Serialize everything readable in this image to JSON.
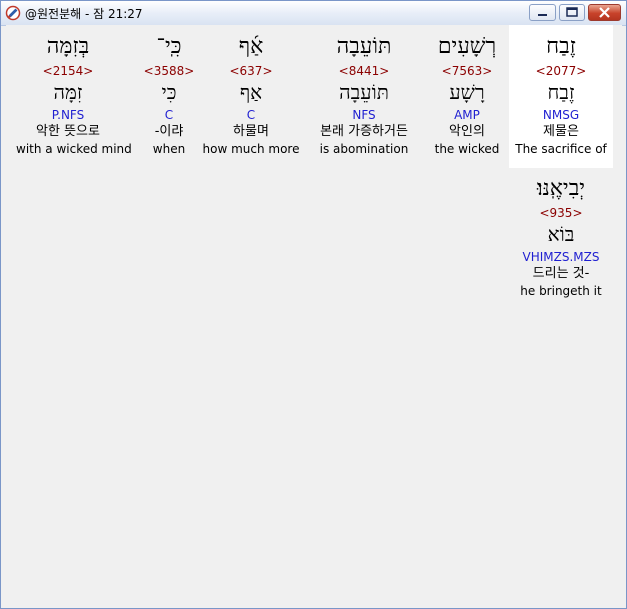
{
  "window": {
    "title": "@원전분해 - 잠 21:27"
  },
  "words": [
    {
      "hebrew": "בְּזִמָּה",
      "strong": "<2154>",
      "root": "זִמָּה",
      "morph": "P.NFS",
      "korean": "악한 뜻으로",
      "english": "with a wicked mind",
      "highlight": false
    },
    {
      "hebrew": "כִּֽי־",
      "strong": "<3588>",
      "root": "כִּי",
      "morph": "C",
      "korean": "-이랴",
      "english": "when",
      "highlight": false
    },
    {
      "hebrew": "אַ֜ף",
      "strong": "<637>",
      "root": "אַף",
      "morph": "C",
      "korean": "하물며",
      "english": "how much more",
      "highlight": false
    },
    {
      "hebrew": "תּוֹעֵבָה",
      "strong": "<8441>",
      "root": "תּוֹעֵבָה",
      "morph": "NFS",
      "korean": "본래 가증하거든",
      "english": "is abomination",
      "highlight": false
    },
    {
      "hebrew": "רְשָׁעִים",
      "strong": "<7563>",
      "root": "רָשָׁע",
      "morph": "AMP",
      "korean": "악인의",
      "english": "the wicked",
      "highlight": false
    },
    {
      "hebrew": "זֶבַח",
      "strong": "<2077>",
      "root": "זֶבַח",
      "morph": "NMSG",
      "korean": "제물은",
      "english": "The sacrifice of",
      "highlight": true
    },
    {
      "hebrew": "יְבִיאֶֽנּוּ׃",
      "strong": "<935>",
      "root": "בּוֹא",
      "morph": "VHIMZS.MZS",
      "korean": "드리는 것-",
      "english": "he bringeth it",
      "highlight": false
    }
  ]
}
